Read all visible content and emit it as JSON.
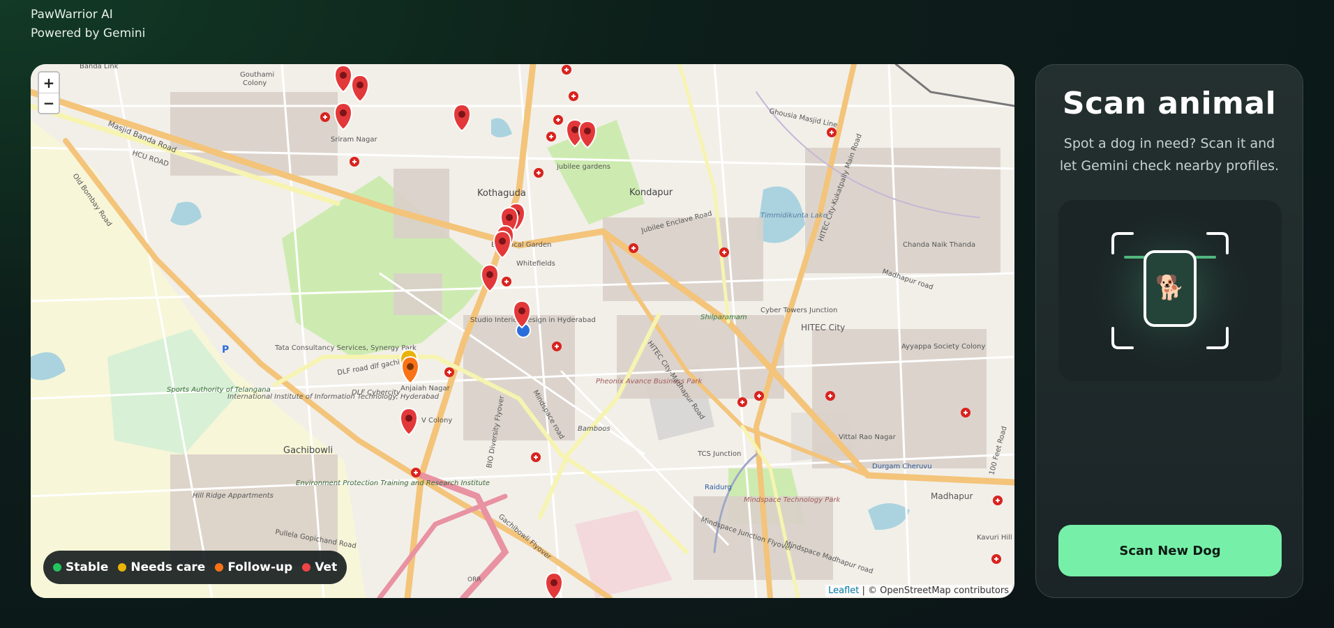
{
  "brand": {
    "name": "PawWarrior AI",
    "tagline": "Powered by Gemini"
  },
  "map": {
    "zoom_in": "+",
    "zoom_out": "−",
    "legend": [
      {
        "label": "Stable",
        "color": "#22c55e"
      },
      {
        "label": "Needs care",
        "color": "#eab308"
      },
      {
        "label": "Follow-up",
        "color": "#f97316"
      },
      {
        "label": "Vet",
        "color": "#ef4444"
      }
    ],
    "attribution_leaflet": "Leaflet",
    "attribution_rest": " | © OpenStreetMap contributors",
    "labels": {
      "banda_link": "Banda Link",
      "gouthami": "Gouthami",
      "colony": "Colony",
      "masjid_banda_road": "Masjid Banda Road",
      "sriram_nagar": "Sriram Nagar",
      "hcu_road": "HCU ROAD",
      "old_bombay_road": "Old Bombay Road",
      "kothaguda": "Kothaguda",
      "kondapur": "Kondapur",
      "jubilee_gardens": "jubilee gardens",
      "botanical_garden": "Botanical Garden",
      "whitefields": "Whitefields",
      "jubilee_enclave_road": "Jubilee Enclave Road",
      "hitec_kukatpally_road": "HITEC City-Kukatpally Main Road",
      "ghousia_masjid": "Ghousia Masjid Line",
      "timmidikunta": "Timmidikunta Lake",
      "chanda_naik": "Chanda Naik Thanda",
      "madhapur_road": "Madhapur road",
      "cyber_towers": "Cyber Towers Junction",
      "hitec_city": "HITEC City",
      "shilparamam": "Shilparamam",
      "studio": "Studio Interior Design in Hyderabad",
      "tcs": "Tata Consultancy Services, Synergy Park",
      "dlf_road": "DLF road dlf gachibowli",
      "dlf_cybercity": "DLF Cybercity",
      "anjaiah": "Anjaiah Nagar",
      "sports_authority": "Sports Authority of Telangana",
      "iiit": "International Institute of Information Technology, Hyderabad",
      "gachibowli": "Gachibowli",
      "v_colony": "V Colony",
      "pheonix": "Pheonix Avance Business Park",
      "bamboos": "Bamboos",
      "mindspace_road": "Mindspace road",
      "hitec_madhapur": "HITEC City-Madhapur Road",
      "tcs_junction": "TCS Junction",
      "raidurg": "Raidurg",
      "mindspace_park": "Mindspace Technology Park",
      "durgam": "Durgam Cheruvu",
      "madhapur": "Madhapur",
      "ayyappa": "Ayyappa Society Colony",
      "vittal_rao": "Vittal Rao Nagar",
      "hill_ridge": "Hill Ridge Appartments",
      "epti": "Environment Protection Training and Research Institute",
      "orr": "ORR",
      "gachibowli_flyover": "Gachibowli Flyover",
      "pullela": "Pullela Gopichand Road",
      "mindspace_flyover": "Mindspace Junction Flyover",
      "mindspace_madhapur": "Mindspace Madhapur road",
      "kavuri": "Kavuri Hill",
      "feet_road": "100 Feet Road",
      "biodiversity": "BIO Diversity Flyover"
    }
  },
  "panel": {
    "title": "Scan animal",
    "description": "Spot a dog in need? Scan it and let Gemini check nearby profiles.",
    "scan_button": "Scan New Dog",
    "preview_emoji": "🐕",
    "accent": "#76f0a8"
  }
}
